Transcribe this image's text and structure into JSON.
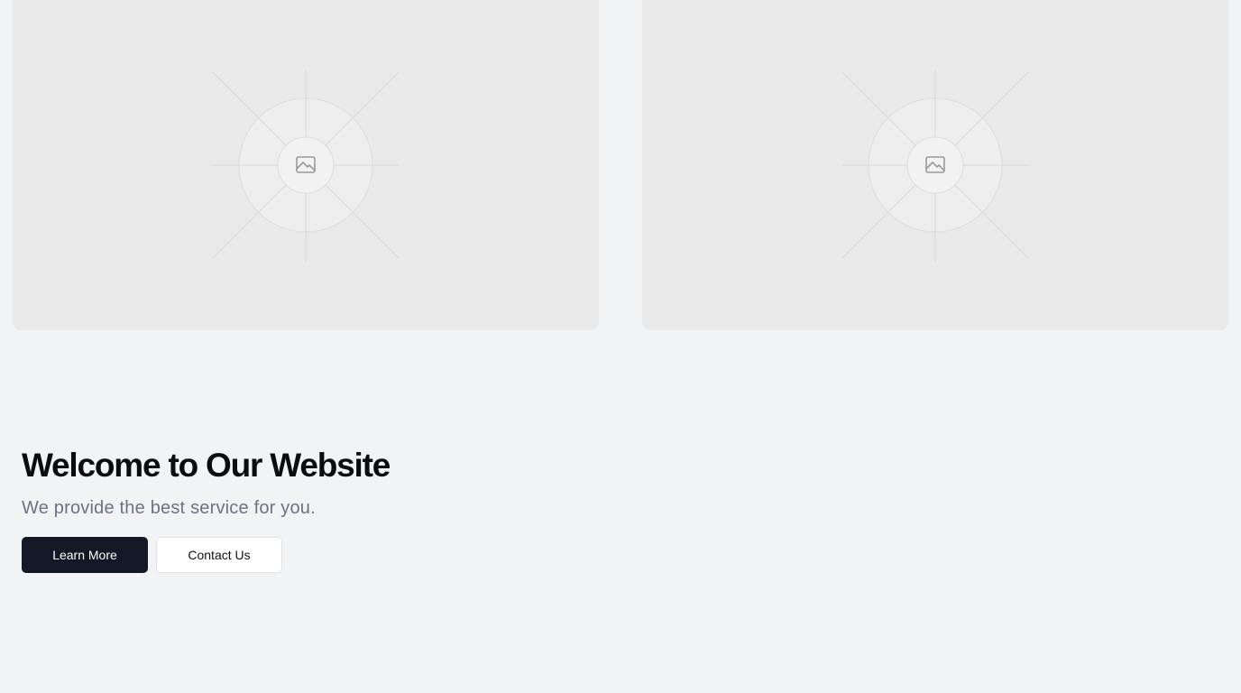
{
  "media": {
    "images": [
      {
        "icon": "image-icon"
      },
      {
        "icon": "image-icon"
      }
    ]
  },
  "hero": {
    "title": "Welcome to Our Website",
    "subtitle": "We provide the best service for you.",
    "primary_button": "Learn More",
    "secondary_button": "Contact Us"
  },
  "colors": {
    "background": "#f2f3f5",
    "placeholder": "#e9e9ea",
    "primary_button_bg": "#121826",
    "subtitle_text": "#6b7280"
  }
}
